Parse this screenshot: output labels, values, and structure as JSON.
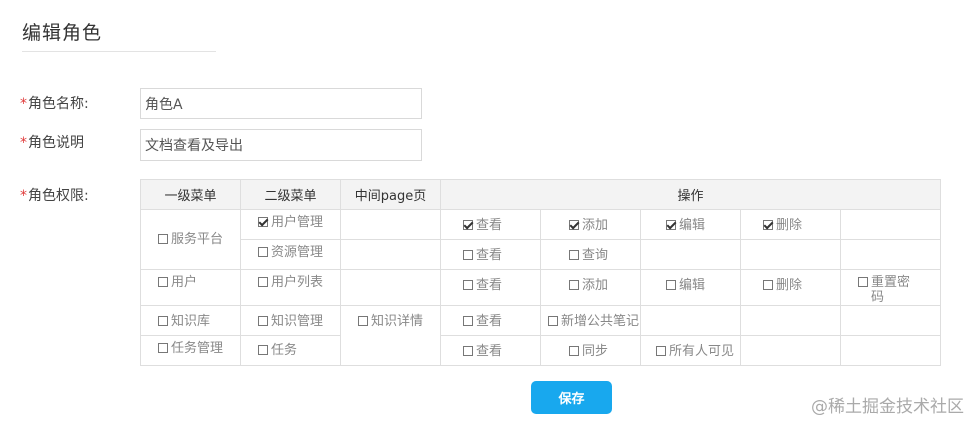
{
  "page": {
    "title": "编辑角色"
  },
  "form": {
    "required_mark": "*",
    "name_label": "角色名称:",
    "name_value": "角色A",
    "desc_label": "角色说明",
    "desc_value": "文档查看及导出",
    "perm_label": "角色权限:"
  },
  "table": {
    "headers": [
      "一级菜单",
      "二级菜单",
      "中间page页",
      "操作"
    ],
    "level1": [
      {
        "label": "服务平台",
        "checked": false
      },
      {
        "label": "用户",
        "checked": false
      },
      {
        "label": "知识库",
        "checked": false
      },
      {
        "label": "任务管理",
        "checked": false
      }
    ],
    "level2": [
      {
        "label": "用户管理",
        "checked": true
      },
      {
        "label": "资源管理",
        "checked": false
      },
      {
        "label": "用户列表",
        "checked": false
      },
      {
        "label": "知识管理",
        "checked": false
      },
      {
        "label": "任务",
        "checked": false
      }
    ],
    "middle_page": [
      {
        "label": "知识详情",
        "checked": false
      }
    ],
    "ops": [
      [
        {
          "label": "查看",
          "checked": true
        },
        {
          "label": "添加",
          "checked": true
        },
        {
          "label": "编辑",
          "checked": true
        },
        {
          "label": "删除",
          "checked": true
        }
      ],
      [
        {
          "label": "查看",
          "checked": false
        },
        {
          "label": "查询",
          "checked": false
        }
      ],
      [
        {
          "label": "查看",
          "checked": false
        },
        {
          "label": "添加",
          "checked": false
        },
        {
          "label": "编辑",
          "checked": false
        },
        {
          "label": "删除",
          "checked": false
        },
        {
          "label": "重置密码",
          "checked": false
        }
      ],
      [
        {
          "label": "查看",
          "checked": false
        },
        {
          "label": "新增公共笔记",
          "checked": false
        }
      ],
      [
        {
          "label": "查看",
          "checked": false
        },
        {
          "label": "同步",
          "checked": false
        },
        {
          "label": "所有人可见",
          "checked": false
        }
      ]
    ]
  },
  "actions": {
    "save_label": "保存"
  },
  "watermark": "@稀土掘金技术社区",
  "colors": {
    "accent": "#18a8ee",
    "required": "#e03a3a",
    "header_bg": "#f3f3f3"
  }
}
